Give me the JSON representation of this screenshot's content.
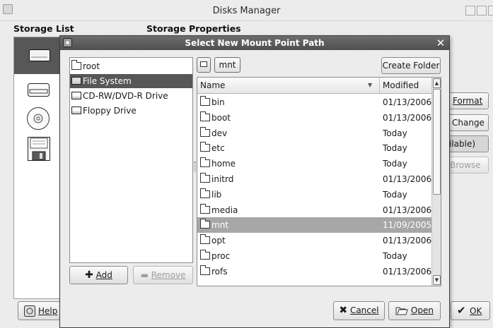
{
  "main_window": {
    "title": "Disks Manager",
    "storage_list_label": "Storage List",
    "storage_properties_label": "Storage Properties",
    "devices": [
      {
        "name": "hard-disk",
        "icon": "hard-disk-icon"
      },
      {
        "name": "removable-drive",
        "icon": "removable-drive-icon"
      },
      {
        "name": "cd-drive",
        "icon": "cdrom-icon"
      },
      {
        "name": "floppy-drive",
        "icon": "floppy-icon"
      }
    ],
    "right_buttons": {
      "format_label": "Format",
      "change_label": "Change",
      "available_text": "ilable)",
      "browse_label": "Browse"
    },
    "help_label": "Help",
    "ok_label": "OK"
  },
  "dialog": {
    "title": "Select New Mount Point Path",
    "places": [
      {
        "label": "root",
        "icon": "home-folder-icon",
        "selected": false
      },
      {
        "label": "File System",
        "icon": "drive-icon",
        "selected": true
      },
      {
        "label": "CD-RW/DVD-R Drive",
        "icon": "drive-icon",
        "selected": false
      },
      {
        "label": "Floppy Drive",
        "icon": "drive-icon",
        "selected": false
      }
    ],
    "add_label": "Add",
    "remove_label": "Remove",
    "path_button": "mnt",
    "create_folder_label": "Create Folder",
    "columns": {
      "name": "Name",
      "modified": "Modified"
    },
    "files": [
      {
        "name": "bin",
        "modified": "01/13/2006"
      },
      {
        "name": "boot",
        "modified": "01/13/2006"
      },
      {
        "name": "dev",
        "modified": "Today"
      },
      {
        "name": "etc",
        "modified": "Today"
      },
      {
        "name": "home",
        "modified": "Today"
      },
      {
        "name": "initrd",
        "modified": "01/13/2006"
      },
      {
        "name": "lib",
        "modified": "Today"
      },
      {
        "name": "media",
        "modified": "01/13/2006"
      },
      {
        "name": "mnt",
        "modified": "11/09/2005",
        "selected": true
      },
      {
        "name": "opt",
        "modified": "01/13/2006"
      },
      {
        "name": "proc",
        "modified": "Today"
      },
      {
        "name": "rofs",
        "modified": "01/13/2006"
      }
    ],
    "cancel_label": "Cancel",
    "open_label": "Open"
  },
  "colors": {
    "selection": "#575757",
    "file_selection": "#a7a7a7",
    "dialog_titlebar": "#5a5a5a"
  }
}
